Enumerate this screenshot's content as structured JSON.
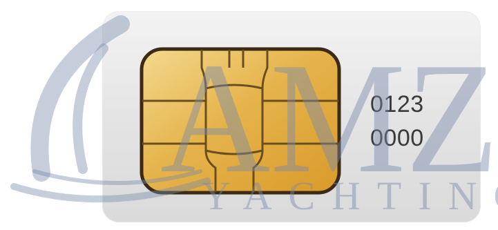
{
  "sim_card": {
    "number_line_1": "0123",
    "number_line_2": "0000",
    "chip_icon": "sim-chip-icon"
  },
  "watermark": {
    "logo_letters": "AMZ",
    "logo_word": "YACHTING",
    "logo_icon": "sail-swoosh-icon",
    "color": "#8a9bbd"
  },
  "colors": {
    "card": "#e6e6e6",
    "chip_gold": "#e8b64a",
    "chip_outline": "#3b2a14",
    "text": "#3a3a3a"
  }
}
